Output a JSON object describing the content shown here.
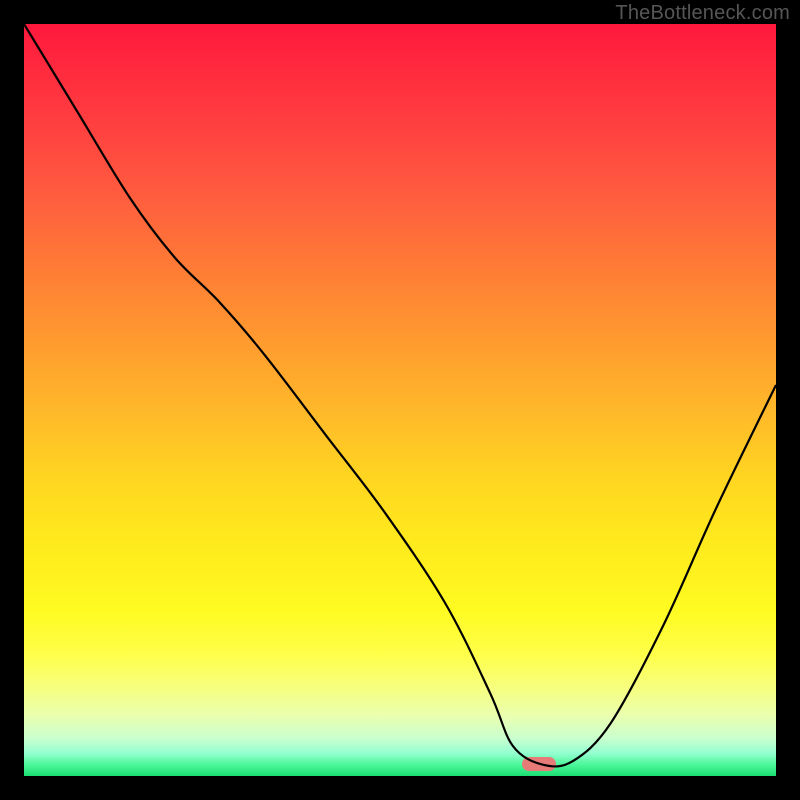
{
  "watermark": "TheBottleneck.com",
  "marker": {
    "cx_frac": 0.685,
    "cy_frac": 0.984,
    "color": "#e77b78"
  },
  "chart_data": {
    "type": "line",
    "title": "",
    "xlabel": "",
    "ylabel": "",
    "xlim": [
      0,
      1
    ],
    "ylim": [
      0,
      1
    ],
    "note": "Axes unlabeled; values are fractional positions read from pixel geometry. y=1 at top (red / high bottleneck), y≈0 at bottom (green / low bottleneck).",
    "series": [
      {
        "name": "bottleneck-curve",
        "x": [
          0.0,
          0.07,
          0.14,
          0.2,
          0.26,
          0.32,
          0.4,
          0.48,
          0.56,
          0.62,
          0.65,
          0.69,
          0.73,
          0.78,
          0.85,
          0.92,
          1.0
        ],
        "y": [
          1.0,
          0.885,
          0.77,
          0.69,
          0.63,
          0.56,
          0.455,
          0.35,
          0.23,
          0.11,
          0.04,
          0.015,
          0.02,
          0.07,
          0.2,
          0.355,
          0.52
        ]
      }
    ],
    "optimum_marker": {
      "x": 0.685,
      "y": 0.016
    }
  }
}
